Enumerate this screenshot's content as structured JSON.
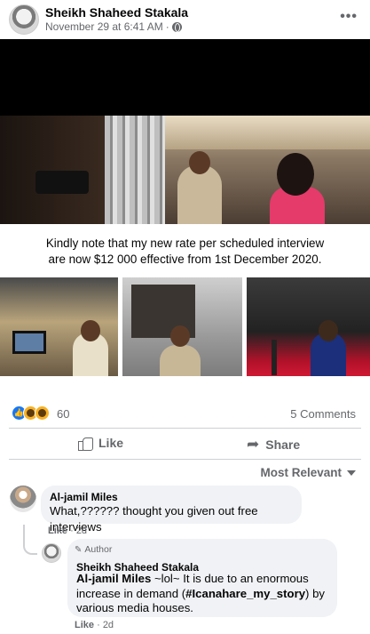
{
  "post": {
    "author": "Sheikh Shaheed Stakala",
    "date": "November 29 at 6:41 AM",
    "audience_separator": "·",
    "more_label": "•••",
    "caption_line1": "Kindly note that my new rate per scheduled interview",
    "caption_line2": "are now $12 000 effective from 1st December 2020."
  },
  "reactions": {
    "count": "60",
    "comments": "5 Comments"
  },
  "actions": {
    "like": "Like",
    "share": "Share"
  },
  "sort": {
    "selected": "Most Relevant"
  },
  "comments": [
    {
      "name": "Al-jamil Miles",
      "text": "What,?????? thought you given out free interviews",
      "like": "Like",
      "sep": "·",
      "age": "2d"
    },
    {
      "badge": "Author",
      "name": "Sheikh Shaheed Stakala",
      "mention": "Al-jamil Miles",
      "text_a": " ~lol~ It is due to an enormous",
      "text_b_pre": "increase in demand (",
      "hashtag": "#Icanahare_my_story",
      "text_b_post": ") by",
      "text_c": "various media houses.",
      "like": "Like",
      "sep": "·",
      "age": "2d"
    }
  ],
  "colors": {
    "secondary_text": "#65676b",
    "bubble_bg": "#f0f2f5",
    "like_blue": "#1877f2"
  },
  "icons": [
    "globe-icon",
    "more-icon",
    "like-reaction-icon",
    "wow-reaction-icon",
    "haha-reaction-icon",
    "like-icon",
    "share-icon",
    "chevron-down-icon",
    "pencil-icon"
  ]
}
